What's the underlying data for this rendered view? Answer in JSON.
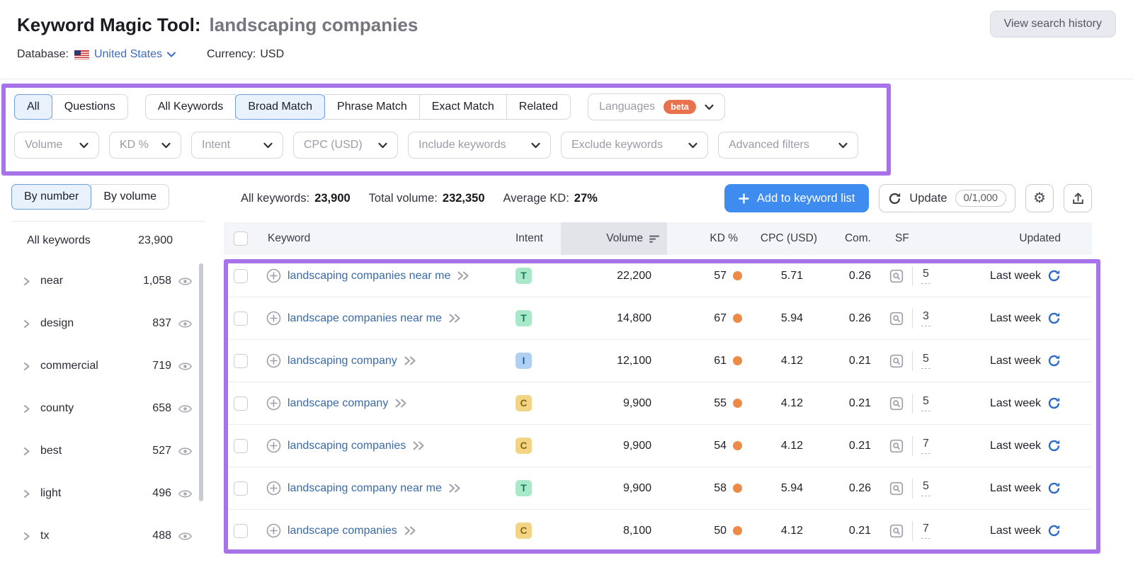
{
  "header": {
    "title": "Keyword Magic Tool:",
    "query": "landscaping companies",
    "view_history_label": "View search history",
    "database_label": "Database:",
    "database_value": "United States",
    "currency_label": "Currency:",
    "currency_value": "USD"
  },
  "filters": {
    "question_tabs": [
      {
        "label": "All",
        "selected": true
      },
      {
        "label": "Questions",
        "selected": false
      }
    ],
    "match_tabs": [
      {
        "label": "All Keywords",
        "selected": false
      },
      {
        "label": "Broad Match",
        "selected": true
      },
      {
        "label": "Phrase Match",
        "selected": false
      },
      {
        "label": "Exact Match",
        "selected": false
      },
      {
        "label": "Related",
        "selected": false
      }
    ],
    "languages_label": "Languages",
    "languages_badge": "beta",
    "dropdowns": [
      {
        "label": "Volume"
      },
      {
        "label": "KD %"
      },
      {
        "label": "Intent"
      },
      {
        "label": "CPC (USD)"
      },
      {
        "label": "Include keywords"
      },
      {
        "label": "Exclude keywords"
      },
      {
        "label": "Advanced filters"
      }
    ]
  },
  "sidebar": {
    "tabs": [
      {
        "label": "By number",
        "selected": true
      },
      {
        "label": "By volume",
        "selected": false
      }
    ],
    "all_keywords_label": "All keywords",
    "all_keywords_count": "23,900",
    "groups": [
      {
        "label": "near",
        "count": "1,058"
      },
      {
        "label": "design",
        "count": "837"
      },
      {
        "label": "commercial",
        "count": "719"
      },
      {
        "label": "county",
        "count": "658"
      },
      {
        "label": "best",
        "count": "527"
      },
      {
        "label": "light",
        "count": "496"
      },
      {
        "label": "tx",
        "count": "488"
      }
    ]
  },
  "toolbar": {
    "stats": [
      {
        "label": "All keywords:",
        "value": "23,900"
      },
      {
        "label": "Total volume:",
        "value": "232,350"
      },
      {
        "label": "Average KD:",
        "value": "27%"
      }
    ],
    "add_to_list_label": "Add to keyword list",
    "update_label": "Update",
    "update_quota": "0/1,000"
  },
  "table": {
    "headers": {
      "keyword": "Keyword",
      "intent": "Intent",
      "volume": "Volume",
      "kd": "KD %",
      "cpc": "CPC (USD)",
      "com": "Com.",
      "sf": "SF",
      "updated": "Updated"
    },
    "rows": [
      {
        "keyword": "landscaping companies near me",
        "intent": "T",
        "volume": "22,200",
        "kd": "57",
        "cpc": "5.71",
        "com": "0.26",
        "sf": "5",
        "updated": "Last week"
      },
      {
        "keyword": "landscape companies near me",
        "intent": "T",
        "volume": "14,800",
        "kd": "67",
        "cpc": "5.94",
        "com": "0.26",
        "sf": "3",
        "updated": "Last week"
      },
      {
        "keyword": "landscaping company",
        "intent": "I",
        "volume": "12,100",
        "kd": "61",
        "cpc": "4.12",
        "com": "0.21",
        "sf": "5",
        "updated": "Last week"
      },
      {
        "keyword": "landscape company",
        "intent": "C",
        "volume": "9,900",
        "kd": "55",
        "cpc": "4.12",
        "com": "0.21",
        "sf": "5",
        "updated": "Last week"
      },
      {
        "keyword": "landscaping companies",
        "intent": "C",
        "volume": "9,900",
        "kd": "54",
        "cpc": "4.12",
        "com": "0.21",
        "sf": "7",
        "updated": "Last week"
      },
      {
        "keyword": "landscaping company near me",
        "intent": "T",
        "volume": "9,900",
        "kd": "58",
        "cpc": "5.94",
        "com": "0.26",
        "sf": "5",
        "updated": "Last week"
      },
      {
        "keyword": "landscape companies",
        "intent": "C",
        "volume": "8,100",
        "kd": "50",
        "cpc": "4.12",
        "com": "0.21",
        "sf": "7",
        "updated": "Last week"
      }
    ]
  },
  "colors": {
    "annotation_purple": "#a873e8",
    "cta_blue": "#3e8cf0",
    "link_blue": "#3a6aa8",
    "kd_orange": "#ed8a48",
    "beta_orange": "#e8724d",
    "refresh_blue": "#2d6cc8",
    "selected_tab_border": "#6d9fd8",
    "selected_tab_bg": "#e9f2fc",
    "intent_transactional_bg": "#a9e8c9",
    "intent_transactional_text": "#0f7a57",
    "intent_informational_bg": "#b0d0f2",
    "intent_informational_text": "#1e5aa0",
    "intent_commercial_bg": "#f2d584",
    "intent_commercial_text": "#8a6516"
  }
}
